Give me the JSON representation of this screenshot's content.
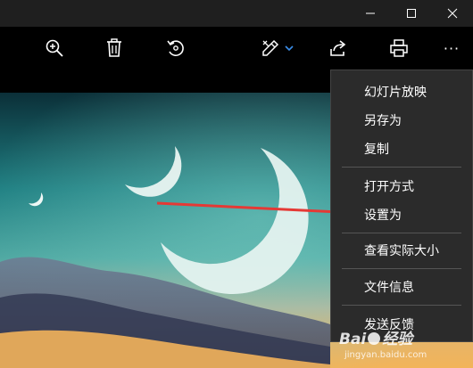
{
  "window_controls": {
    "minimize_icon": "minimize-icon",
    "maximize_icon": "maximize-icon",
    "close_icon": "close-icon"
  },
  "toolbar": {
    "icons": [
      "zoom-in-icon",
      "delete-icon",
      "rotate-icon",
      "edit-draw-icon",
      "share-icon",
      "print-icon",
      "more-icon"
    ],
    "more_label": "···"
  },
  "context_menu": {
    "items": [
      {
        "label": "幻灯片放映"
      },
      {
        "label": "另存为"
      },
      {
        "label": "复制"
      },
      {
        "label": "打开方式"
      },
      {
        "label": "设置为"
      },
      {
        "label": "查看实际大小"
      },
      {
        "label": "文件信息"
      },
      {
        "label": "发送反馈"
      }
    ]
  },
  "watermark": {
    "brand": "Bai",
    "brand_suffix": "经验",
    "url": "jingyan.baidu.com"
  },
  "colors": {
    "accent": "#3b8eea",
    "arrow": "#e53935",
    "menu_bg": "#2b2b2b"
  }
}
